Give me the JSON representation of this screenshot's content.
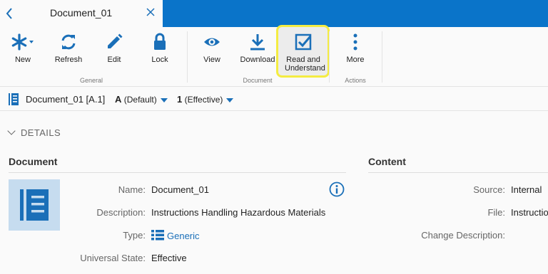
{
  "tab": {
    "title": "Document_01"
  },
  "toolbar": {
    "groups": [
      {
        "label": "General"
      },
      {
        "label": "Document"
      },
      {
        "label": "Actions"
      }
    ],
    "buttons": {
      "new": "New",
      "refresh": "Refresh",
      "edit": "Edit",
      "lock": "Lock",
      "view": "View",
      "download": "Download",
      "read_understand": "Read and Understand",
      "more": "More"
    }
  },
  "breadcrumb": {
    "name": "Document_01 [A.1]",
    "revision_letter": "A",
    "revision_label": "(Default)",
    "version_number": "1",
    "version_label": "(Effective)"
  },
  "details": {
    "heading": "DETAILS",
    "document": {
      "heading": "Document",
      "fields": {
        "name_label": "Name:",
        "name_value": "Document_01",
        "description_label": "Description:",
        "description_value": "Instructions Handling Hazardous Materials",
        "type_label": "Type:",
        "type_value": "Generic",
        "state_label": "Universal State:",
        "state_value": "Effective"
      }
    },
    "content": {
      "heading": "Content",
      "fields": {
        "source_label": "Source:",
        "source_value": "Internal",
        "file_label": "File:",
        "file_value": "Instructio",
        "change_label": "Change Description:"
      }
    }
  },
  "colors": {
    "accent": "#0a74c9",
    "link": "#1a6fb8",
    "highlight": "#f4ec42",
    "icon_bg": "#c6dcef"
  }
}
